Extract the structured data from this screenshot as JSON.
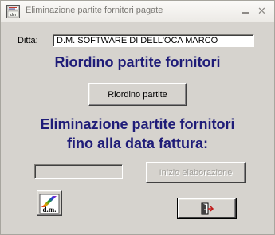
{
  "window": {
    "title": "Eliminazione partite fornitori pagate",
    "app_icon": "report-app-icon",
    "controls": {
      "minimize_icon": "minimize-icon",
      "close_icon": "close-icon",
      "close_glyph": "✕"
    }
  },
  "ditta": {
    "label": "Ditta:",
    "value": "D.M. SOFTWARE DI DELL'OCA MARCO"
  },
  "riordino": {
    "heading": "Riordino partite fornitori",
    "button_label": "Riordino partite"
  },
  "eliminazione": {
    "heading_line1": "Eliminazione partite fornitori",
    "heading_line2": "fino alla data fattura:",
    "date_value": "",
    "start_button_label": "Inizio elaborazione"
  },
  "bottom": {
    "logo_text": "d.m.",
    "logo_icon": "dm-logo-icon",
    "exit_icon": "exit-door-icon"
  },
  "colors": {
    "heading": "#1f1c78",
    "face": "#d6d3ce"
  }
}
